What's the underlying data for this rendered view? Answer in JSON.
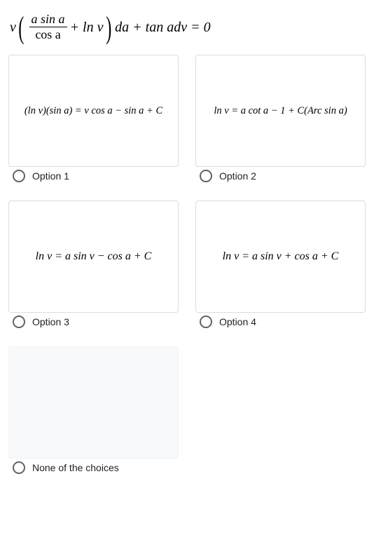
{
  "question": {
    "frac_num": "a sin a",
    "frac_den": "cos a",
    "pre_frac": "v",
    "mid": " + ln v",
    "post_paren": "da + tan adv = 0"
  },
  "options": {
    "o1": {
      "label": "Option 1",
      "formula": "(ln v)(sin a) = v cos a − sin a + C"
    },
    "o2": {
      "label": "Option 2",
      "formula": "ln v = a cot a − 1 + C(Arc sin a)"
    },
    "o3": {
      "label": "Option 3",
      "formula": "ln v = a sin v − cos a + C"
    },
    "o4": {
      "label": "Option 4",
      "formula": "ln v = a sin v + cos a + C"
    },
    "none": {
      "label": "None of the choices"
    }
  }
}
